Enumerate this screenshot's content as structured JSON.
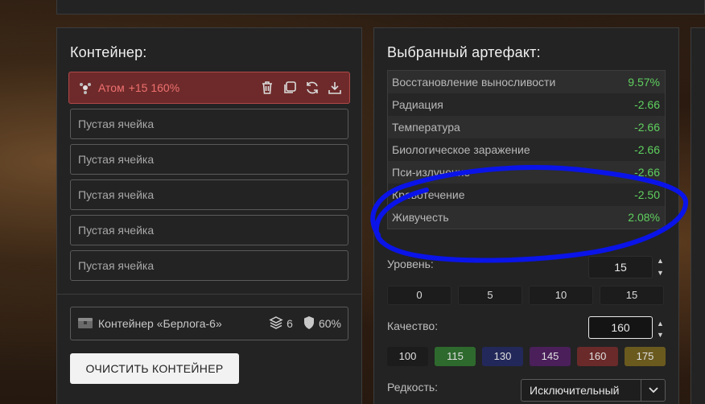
{
  "container_panel": {
    "title": "Контейнер:",
    "active_slot": {
      "name": "Атом",
      "detail": "+15 160%",
      "icon": "atom-icon"
    },
    "empty_slots": [
      "Пустая ячейка",
      "Пустая ячейка",
      "Пустая ячейка",
      "Пустая ячейка",
      "Пустая ячейка"
    ],
    "container": {
      "name": "Контейнер «Берлога-6»",
      "slots": "6",
      "protection": "60%"
    },
    "clear_button": "ОЧИСТИТЬ КОНТЕЙНЕР"
  },
  "artifact_panel": {
    "title": "Выбранный артефакт:",
    "properties": [
      {
        "name": "Восстановление выносливости",
        "value": "9.57%"
      },
      {
        "name": "Радиация",
        "value": "-2.66"
      },
      {
        "name": "Температура",
        "value": "-2.66"
      },
      {
        "name": "Биологическое заражение",
        "value": "-2.66"
      },
      {
        "name": "Пси-излучение",
        "value": "-2.66"
      },
      {
        "name": "Кровотечение",
        "value": "-2.50"
      },
      {
        "name": "Живучесть",
        "value": "2.08%"
      }
    ],
    "level": {
      "label": "Уровень:",
      "value": "15",
      "presets": [
        "0",
        "5",
        "10",
        "15"
      ]
    },
    "quality": {
      "label": "Качество:",
      "value": "160",
      "presets": [
        {
          "label": "100",
          "color": "#1c1c1c"
        },
        {
          "label": "115",
          "color": "#2e6a2e"
        },
        {
          "label": "130",
          "color": "#23285a"
        },
        {
          "label": "145",
          "color": "#4a1f5a"
        },
        {
          "label": "160",
          "color": "#6a2a2a"
        },
        {
          "label": "175",
          "color": "#6a5a1e"
        }
      ]
    },
    "rarity": {
      "label": "Редкость:",
      "value": "Исключительный"
    }
  },
  "colors": {
    "positive": "#5fd05f",
    "annotation": "#0a14e8",
    "active_slot": "#6e2a2a"
  }
}
